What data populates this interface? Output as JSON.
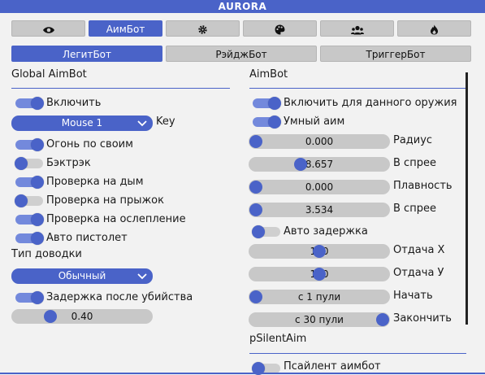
{
  "app": {
    "title": "AURORA"
  },
  "top_tabs": [
    {
      "label": "",
      "icon": "eye-icon"
    },
    {
      "label": "АимБот",
      "icon": ""
    },
    {
      "label": "",
      "icon": "gear-icon"
    },
    {
      "label": "",
      "icon": "palette-icon"
    },
    {
      "label": "",
      "icon": "users-icon"
    },
    {
      "label": "",
      "icon": "flame-icon"
    }
  ],
  "sub_tabs": [
    "ЛегитБот",
    "РэйджБот",
    "ТриггерБот"
  ],
  "left": {
    "header": "Global AimBot",
    "enable": {
      "label": "Включить",
      "on": true
    },
    "key_combo": {
      "value": "Mouse 1",
      "label": "Key"
    },
    "friendly_fire": {
      "label": "Огонь по своим",
      "on": true
    },
    "backtrack": {
      "label": "Бэктрэк",
      "on": false
    },
    "smoke_check": {
      "label": "Проверка на дым",
      "on": true
    },
    "jump_check": {
      "label": "Проверка на прыжок",
      "on": false
    },
    "flash_check": {
      "label": "Проверка на ослепление",
      "on": true
    },
    "auto_pistol": {
      "label": "Авто пистолет",
      "on": true
    },
    "aim_type_label": "Тип доводки",
    "aim_type_combo": {
      "value": "Обычный"
    },
    "kill_delay": {
      "label": "Задержка после убийства",
      "on": true
    },
    "kill_delay_slider": {
      "value": "0.40",
      "fraction": 0.25
    }
  },
  "right": {
    "header": "AimBot",
    "weapon_enable": {
      "label": "Включить для данного оружия",
      "on": true
    },
    "smart_aim": {
      "label": "Умный аим",
      "on": true
    },
    "radius": {
      "value": "0.000",
      "label": "Радиус",
      "fraction": 0.0
    },
    "radius_spray": {
      "value": "8.657",
      "label": "В спрее",
      "fraction": 0.35
    },
    "smooth": {
      "value": "0.000",
      "label": "Плавность",
      "fraction": 0.0
    },
    "smooth_spray": {
      "value": "3.534",
      "label": "В спрее",
      "fraction": 0.0
    },
    "auto_delay": {
      "label": "Авто задержка",
      "on": false
    },
    "recoil_x": {
      "value": "100",
      "label": "Отдача X",
      "fraction": 0.5
    },
    "recoil_y": {
      "value": "100",
      "label": "Отдача У",
      "fraction": 0.5
    },
    "start": {
      "value": "с 1 пули",
      "label": "Начать",
      "fraction": 0.0
    },
    "end": {
      "value": "с 30 пули",
      "label": "Закончить",
      "fraction": 1.0
    },
    "psilent_header": "pSilentAim",
    "psilent_enable": {
      "label": "Псайлент аимбот",
      "on": false
    }
  },
  "colors": {
    "accent": "#4a63c8",
    "track": "#c8c8c8",
    "bg": "#f2f2f2"
  }
}
